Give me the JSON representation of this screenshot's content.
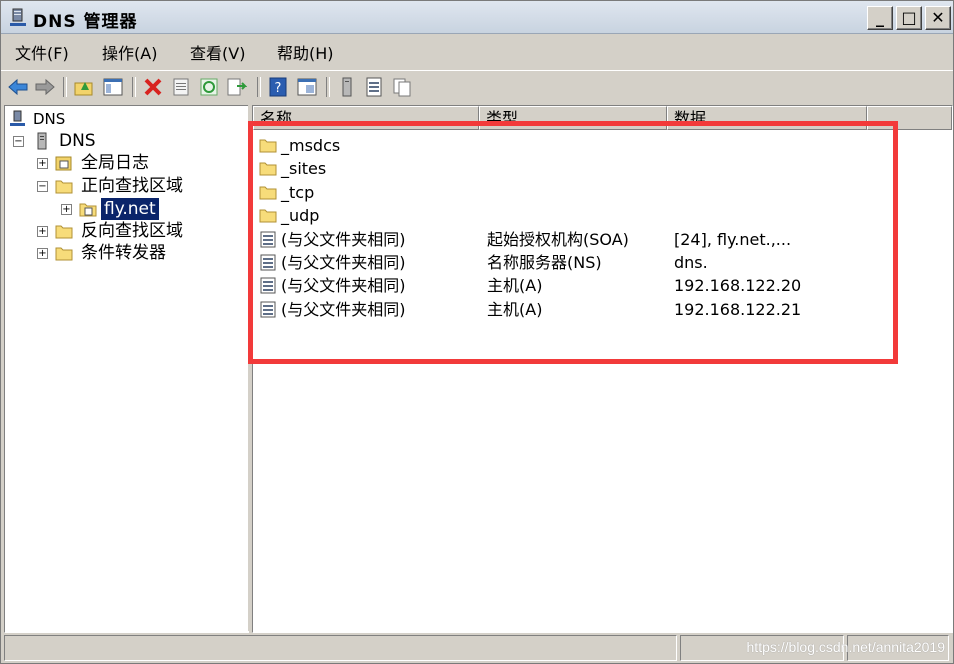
{
  "window": {
    "title": "DNS 管理器",
    "buttons": [
      "_",
      "□",
      "✕"
    ]
  },
  "menu": [
    "文件(F)",
    "操作(A)",
    "查看(V)",
    "帮助(H)"
  ],
  "toolbar": {
    "icons": [
      "back-arrow-icon",
      "forward-arrow-icon",
      "up-folder-icon",
      "show-tree-icon",
      "delete-icon",
      "properties-icon",
      "refresh-icon",
      "export-list-icon",
      "help-icon",
      "console-icon",
      "server-icon",
      "record-icon",
      "copy-icon"
    ]
  },
  "tree": {
    "root": "DNS",
    "server": "DNS",
    "global_logs": "全局日志",
    "forward_zones": "正向查找区域",
    "selected_zone": "fly.net",
    "reverse_zones": "反向查找区域",
    "conditional_forwarders": "条件转发器"
  },
  "list": {
    "columns": [
      "名称",
      "类型",
      "数据"
    ],
    "rows": [
      {
        "icon": "folder-icon",
        "name": "_msdcs",
        "type": "",
        "data": ""
      },
      {
        "icon": "folder-icon",
        "name": "_sites",
        "type": "",
        "data": ""
      },
      {
        "icon": "folder-icon",
        "name": "_tcp",
        "type": "",
        "data": ""
      },
      {
        "icon": "folder-icon",
        "name": "_udp",
        "type": "",
        "data": ""
      },
      {
        "icon": "record-icon",
        "name": "(与父文件夹相同)",
        "type": "起始授权机构(SOA)",
        "data": "[24], fly.net.,..."
      },
      {
        "icon": "record-icon",
        "name": "(与父文件夹相同)",
        "type": "名称服务器(NS)",
        "data": "dns."
      },
      {
        "icon": "record-icon",
        "name": "(与父文件夹相同)",
        "type": "主机(A)",
        "data": "192.168.122.20"
      },
      {
        "icon": "record-icon",
        "name": "(与父文件夹相同)",
        "type": "主机(A)",
        "data": "192.168.122.21"
      }
    ]
  },
  "status": {
    "watermark": "https://blog.csdn.net/annita2019"
  },
  "colors": {
    "highlight": "#f23a3a",
    "selection": "#0a246a",
    "chrome": "#d4d0c8"
  }
}
